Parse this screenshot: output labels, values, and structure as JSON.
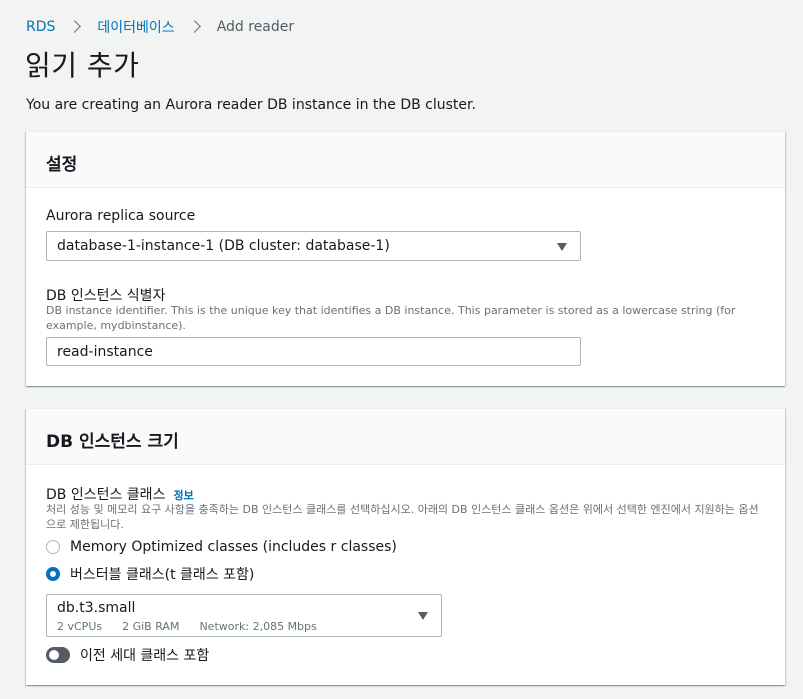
{
  "breadcrumb": {
    "items": [
      "RDS",
      "데이터베이스"
    ],
    "current": "Add reader"
  },
  "page": {
    "title": "읽기 추가",
    "description": "You are creating an Aurora reader DB instance in the DB cluster."
  },
  "settings": {
    "header": "설정",
    "replica_source": {
      "label": "Aurora replica source",
      "value": "database-1-instance-1 (DB cluster: database-1)"
    },
    "identifier": {
      "label": "DB 인스턴스 식별자",
      "description": "DB instance identifier. This is the unique key that identifies a DB instance. This parameter is stored as a lowercase string (for example, mydbinstance).",
      "value": "read-instance"
    }
  },
  "instance_size": {
    "header": "DB 인스턴스 크기",
    "class_label": "DB 인스턴스 클래스",
    "info": "정보",
    "class_description": "처리 성능 및 메모리 요구 사항을 충족하는 DB 인스턴스 클래스를 선택하십시오. 아래의 DB 인스턴스 클래스 옵션은 위에서 선택한 엔진에서 지원하는 옵션으로 제한됩니다.",
    "options": [
      {
        "label": "Memory Optimized classes (includes r classes)",
        "selected": false
      },
      {
        "label": "버스터블 클래스(t 클래스 포함)",
        "selected": true
      }
    ],
    "selected_class": {
      "name": "db.t3.small",
      "vcpu": "2 vCPUs",
      "ram": "2 GiB RAM",
      "network": "Network: 2,085 Mbps"
    },
    "toggle_label": "이전 세대 클래스 포함",
    "toggle_on": false
  },
  "colors": {
    "link": "#0073bb",
    "radio_selected": "#0073bb",
    "background": "#f2f3f3"
  }
}
